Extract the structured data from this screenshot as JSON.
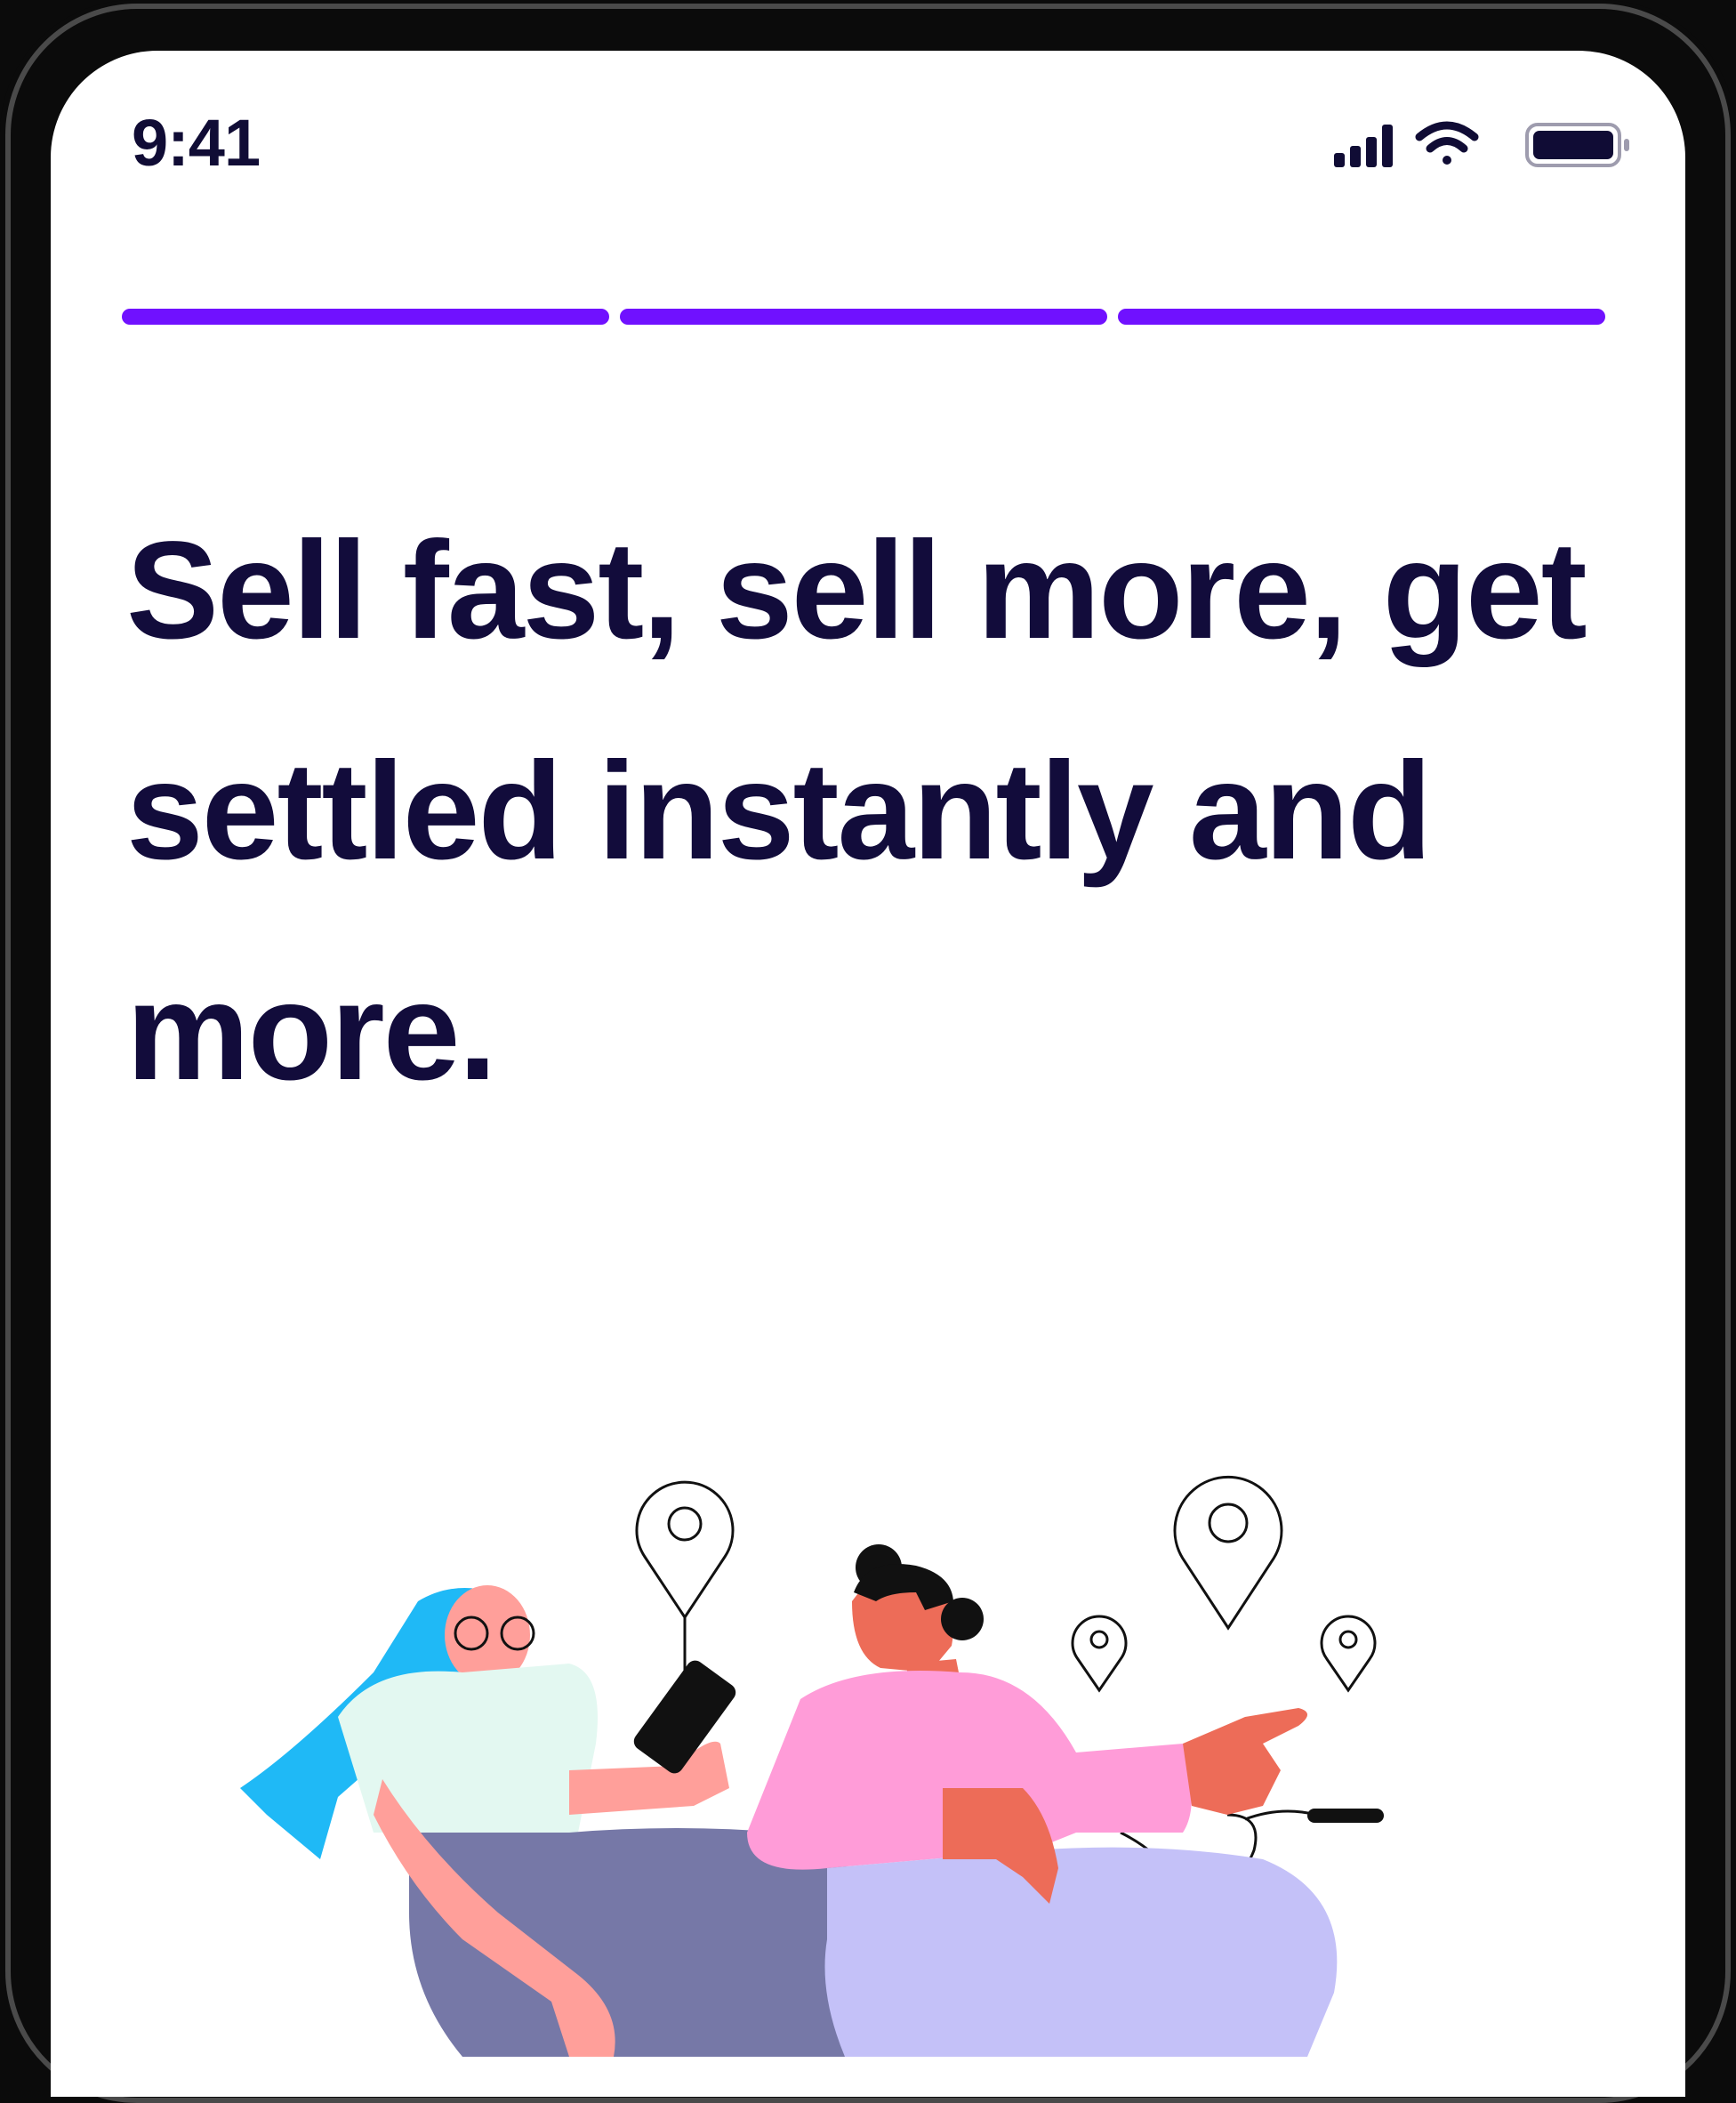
{
  "status_bar": {
    "time": "9:41",
    "icons": [
      "signal-icon",
      "wifi-icon",
      "battery-icon"
    ]
  },
  "onboarding": {
    "progress": {
      "total_steps": 3,
      "completed_steps": 3
    },
    "headline": "Sell fast, sell more, get settled instantly and more.",
    "illustration": "two-people-on-bicycles-with-location-pins"
  },
  "colors": {
    "accent": "#7011ff",
    "headline": "#120c3b",
    "background": "#ffffff"
  }
}
